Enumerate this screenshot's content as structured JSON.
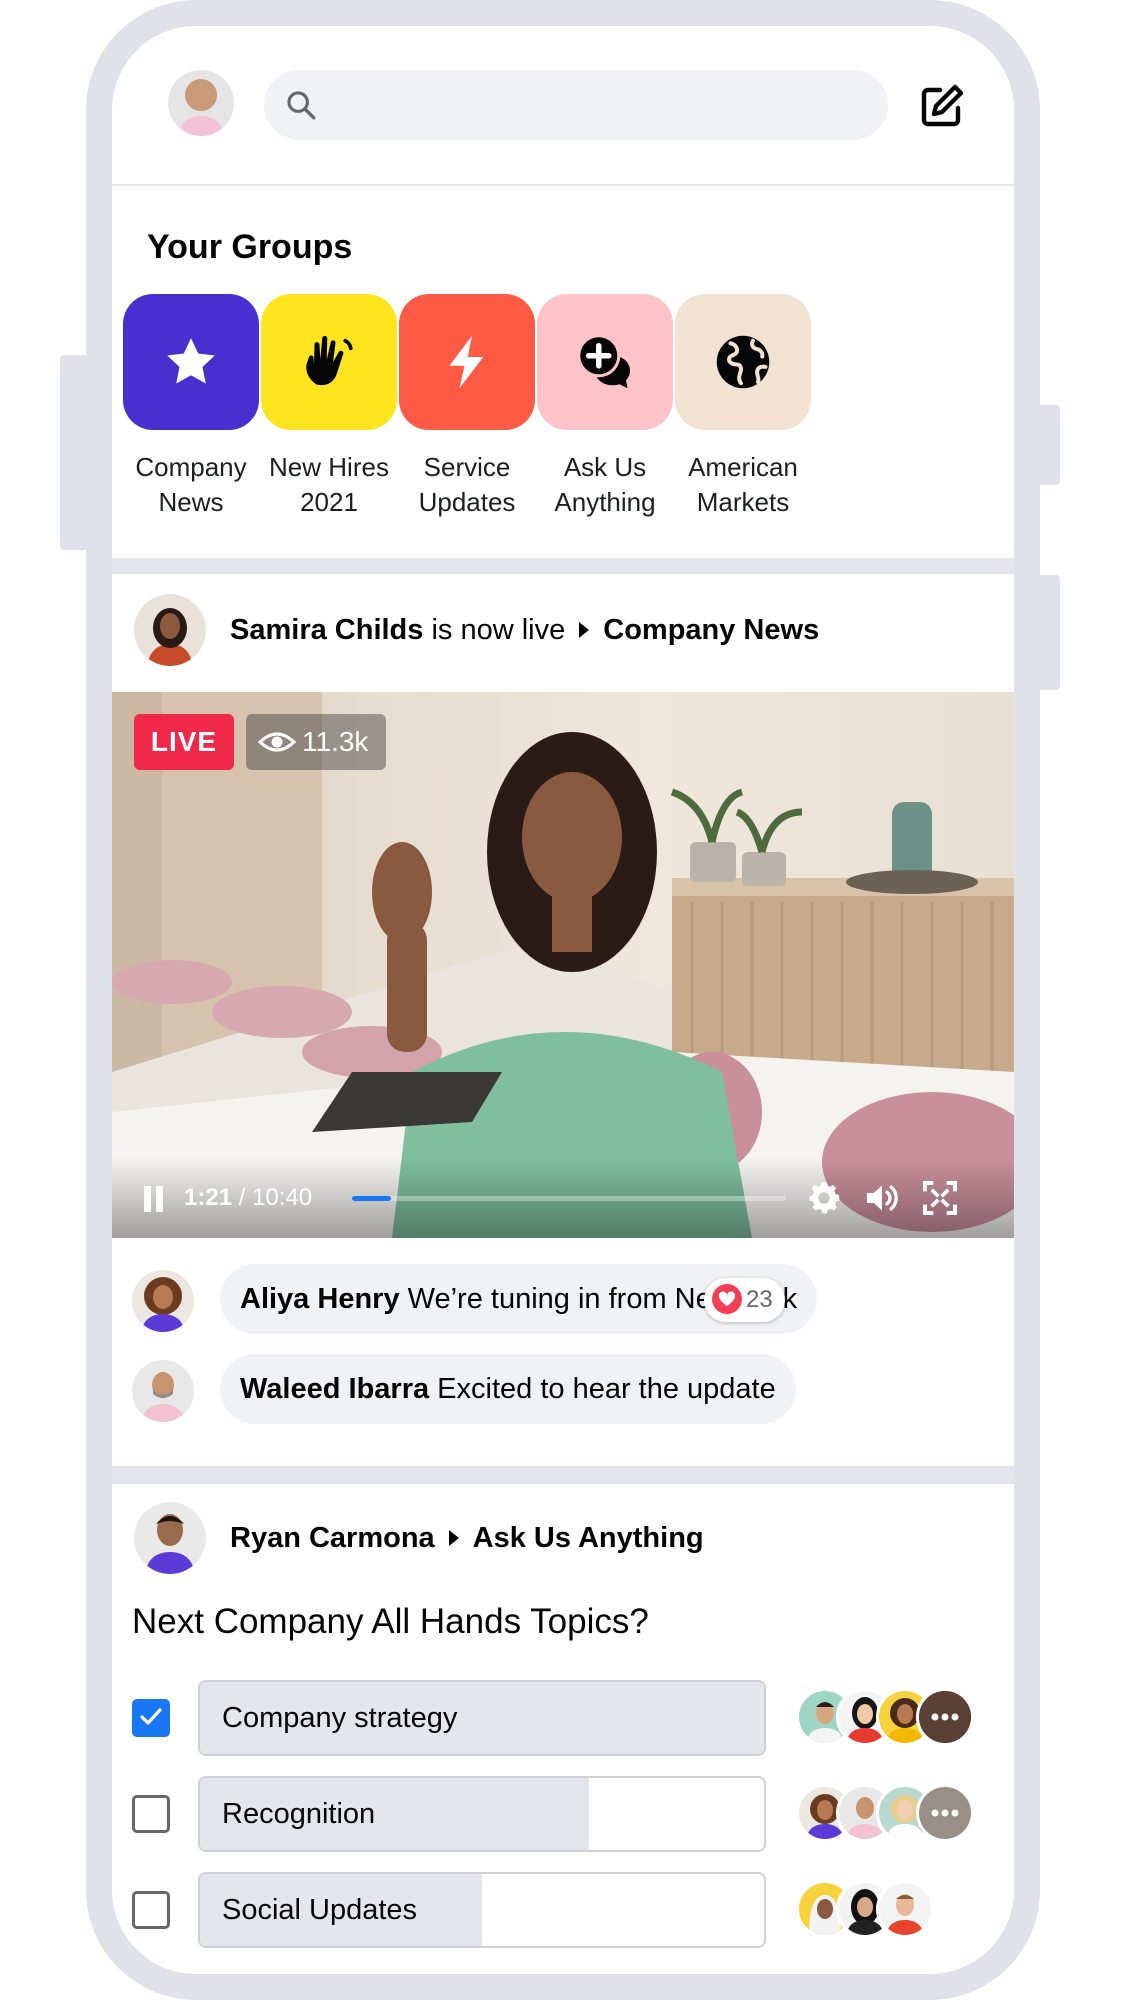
{
  "top_bar": {
    "search_placeholder": "",
    "icons": [
      "profile-avatar",
      "search-icon",
      "compose-icon"
    ]
  },
  "groups": {
    "title": "Your Groups",
    "items": [
      {
        "label": "Company\nNews",
        "color": "#4a2fd0",
        "icon": "star-icon"
      },
      {
        "label": "New Hires\n2021",
        "color": "#ffe41e",
        "icon": "wave-hand-icon"
      },
      {
        "label": "Service\nUpdates",
        "color": "#ff5a44",
        "icon": "lightning-icon"
      },
      {
        "label": "Ask Us\nAnything",
        "color": "#ffc3c8",
        "icon": "chat-bubbles-icon"
      },
      {
        "label": "American\nMarkets",
        "color": "#f2e2d1",
        "icon": "globe-icon"
      }
    ]
  },
  "live_post": {
    "author": "Samira Childs",
    "status_text": "is now live",
    "group": "Company News",
    "live_label": "LIVE",
    "viewers": "11.3k",
    "time_current": "1:21",
    "time_separator": " / ",
    "time_total": "10:40",
    "progress_fraction": 0.09,
    "comments": [
      {
        "author": "Aliya Henry",
        "text": "We’re tuning in from New York",
        "reaction_count": "23"
      },
      {
        "author": "Waleed Ibarra",
        "text": "Excited to hear the update"
      }
    ]
  },
  "poll_post": {
    "author": "Ryan Carmona",
    "group": "Ask Us Anything",
    "question": "Next Company All Hands Topics?",
    "options": [
      {
        "label": "Company strategy",
        "checked": true,
        "fill_fraction": 1.0
      },
      {
        "label": "Recognition",
        "checked": false,
        "fill_fraction": 0.69
      },
      {
        "label": "Social Updates",
        "checked": false,
        "fill_fraction": 0.5
      }
    ]
  },
  "colors": {
    "accent": "#1877f2",
    "live_red": "#f02849",
    "heart": "#f33e58"
  }
}
